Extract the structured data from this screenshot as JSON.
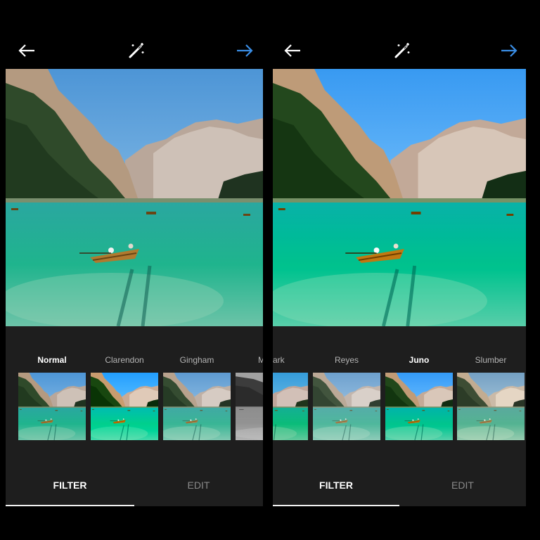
{
  "colors": {
    "accent_blue": "#3a8ee6",
    "panel_bg": "#1e1e1e",
    "label_dim": "#b4b4b4",
    "tab_dim": "#8a8a8a"
  },
  "icons": {
    "back": "back-arrow-icon",
    "magic": "magic-wand-icon",
    "next": "next-arrow-icon"
  },
  "left_screen": {
    "filters": [
      {
        "label": "Normal",
        "selected": true
      },
      {
        "label": "Clarendon",
        "selected": false
      },
      {
        "label": "Gingham",
        "selected": false
      },
      {
        "label": "M",
        "selected": false
      }
    ],
    "tabs": [
      {
        "label": "FILTER",
        "active": true
      },
      {
        "label": "EDIT",
        "active": false
      }
    ]
  },
  "right_screen": {
    "filters": [
      {
        "label": "ark",
        "selected": false
      },
      {
        "label": "Reyes",
        "selected": false
      },
      {
        "label": "Juno",
        "selected": true
      },
      {
        "label": "Slumber",
        "selected": false
      }
    ],
    "tabs": [
      {
        "label": "FILTER",
        "active": true
      },
      {
        "label": "EDIT",
        "active": false
      }
    ]
  }
}
